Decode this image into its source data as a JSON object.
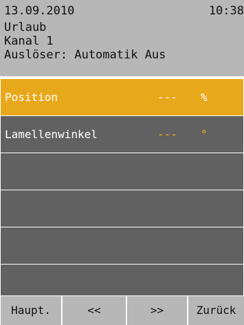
{
  "header": {
    "date": "13.09.2010",
    "time": "10:38",
    "mode": "Urlaub",
    "channel": "Kanal 1",
    "trigger": "Auslöser: Automatik Aus"
  },
  "rows": [
    {
      "label": "Position",
      "value": "---",
      "unit": "%",
      "selected": true
    },
    {
      "label": "Lamellenwinkel",
      "value": "---",
      "unit": "°",
      "selected": false
    },
    {
      "label": "",
      "value": "",
      "unit": ""
    },
    {
      "label": "",
      "value": "",
      "unit": ""
    },
    {
      "label": "",
      "value": "",
      "unit": ""
    },
    {
      "label": "",
      "value": "",
      "unit": ""
    }
  ],
  "footer": {
    "main_label": "Haupt.",
    "prev_label": "<<",
    "next_label": ">>",
    "back_label": "Zurück"
  },
  "colors": {
    "header_bg": "#b7b7b7",
    "row_bg": "#616161",
    "selected_bg": "#e8a81c",
    "value_accent": "#f5b71c"
  }
}
